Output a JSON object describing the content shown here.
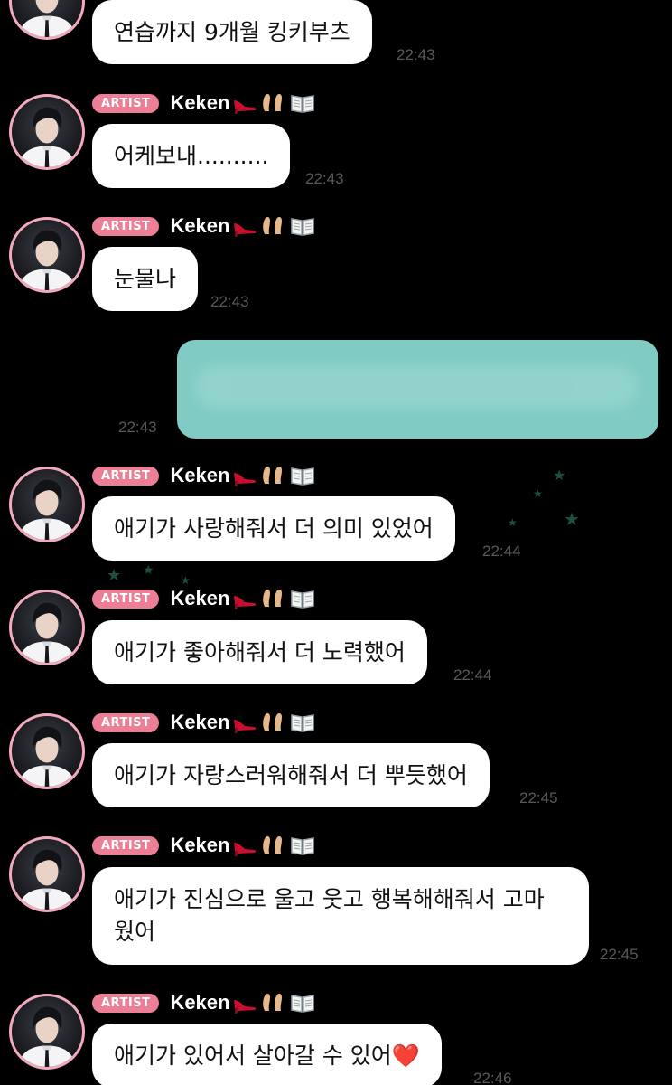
{
  "badge_label": "ARTIST",
  "sender_name": "Keken",
  "sender_emojis": [
    "high-heel-icon",
    "feet-icon",
    "book-icon"
  ],
  "colors": {
    "background": "#000000",
    "badge": "#ec7f95",
    "avatar_ring": "#f3a9bd",
    "bubble": "#ffffff",
    "sent_bubble": "#80ccc4",
    "timestamp": "#595959"
  },
  "messages": [
    {
      "text": "연습까지 9개월 킹키부츠",
      "time": "22:43"
    },
    {
      "text": "어케보내..........",
      "time": "22:43"
    },
    {
      "text": "눈물나",
      "time": "22:43"
    },
    {
      "text": "",
      "time": "22:43"
    },
    {
      "text": "애기가 사랑해줘서 더 의미 있었어",
      "time": "22:44"
    },
    {
      "text": "애기가 좋아해줘서 더 노력했어",
      "time": "22:44"
    },
    {
      "text": "애기가 자랑스러워해줘서 더 뿌듯했어",
      "time": "22:45"
    },
    {
      "text": "애기가 진심으로 울고 웃고 행복해해줘서 고마\n웠어",
      "time": "22:45"
    },
    {
      "text": "애기가 있어서 살아갈 수 있어❤️",
      "time": "22:46"
    }
  ]
}
